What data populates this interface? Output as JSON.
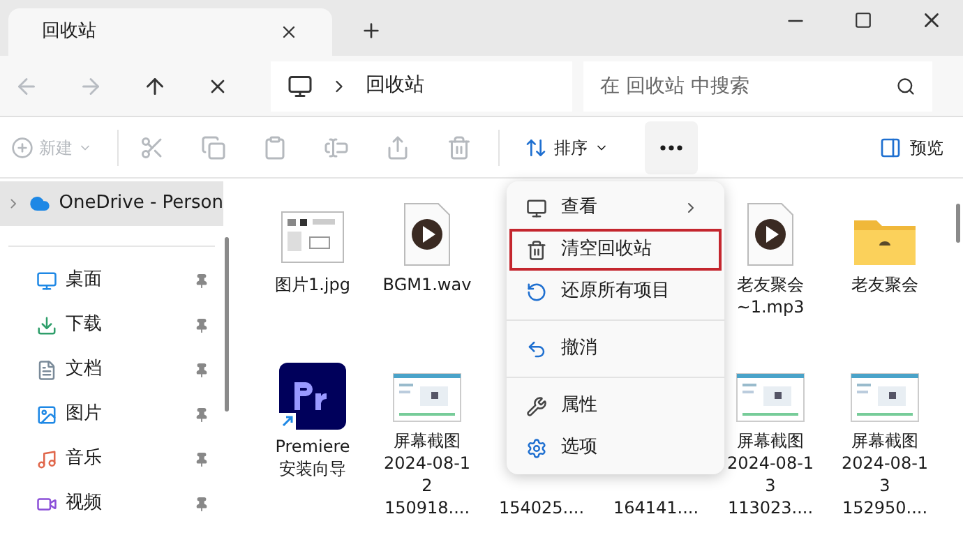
{
  "window": {
    "tab_title": "回收站"
  },
  "address": {
    "crumb": "回收站",
    "search_placeholder": "在 回收站 中搜索"
  },
  "toolbar": {
    "new": {
      "label": "新建",
      "disabled": true
    },
    "sort": {
      "label": "排序"
    },
    "preview": {
      "label": "预览"
    }
  },
  "sidebar": {
    "onedrive": {
      "label": "OneDrive - Person",
      "expanded": false
    },
    "items": [
      {
        "label": "桌面",
        "kind": "desktop",
        "pinned": true
      },
      {
        "label": "下载",
        "kind": "download",
        "pinned": true
      },
      {
        "label": "文档",
        "kind": "document",
        "pinned": true
      },
      {
        "label": "图片",
        "kind": "pictures",
        "pinned": true
      },
      {
        "label": "音乐",
        "kind": "music",
        "pinned": true
      },
      {
        "label": "视频",
        "kind": "video",
        "pinned": true
      }
    ]
  },
  "files": [
    {
      "kind": "image",
      "lines": [
        "图片1.jpg"
      ]
    },
    {
      "kind": "audio",
      "lines": [
        "BGM1.wav"
      ]
    },
    {
      "kind": "covered"
    },
    {
      "kind": "covered"
    },
    {
      "kind": "audio",
      "lines": [
        "老友聚会",
        "~1.mp3"
      ]
    },
    {
      "kind": "folder",
      "lines": [
        "老友聚会"
      ]
    },
    {
      "kind": "app",
      "lines": [
        "Premiere",
        "安装向导"
      ]
    },
    {
      "kind": "screenshot",
      "lines": [
        "屏幕截图",
        "2024-08-1",
        "2",
        "150918...."
      ]
    },
    {
      "kind": "covered",
      "lines": [
        "154025...."
      ]
    },
    {
      "kind": "covered",
      "lines": [
        "164141...."
      ]
    },
    {
      "kind": "screenshot",
      "lines": [
        "屏幕截图",
        "2024-08-1",
        "3",
        "113023...."
      ]
    },
    {
      "kind": "screenshot",
      "lines": [
        "屏幕截图",
        "2024-08-1",
        "3",
        "152950...."
      ]
    }
  ],
  "menu": [
    {
      "label": "查看",
      "kind": "view",
      "submenu": true,
      "highlighted": false,
      "separator_before": false
    },
    {
      "label": "清空回收站",
      "kind": "empty",
      "submenu": false,
      "highlighted": true,
      "separator_before": false
    },
    {
      "label": "还原所有项目",
      "kind": "restore",
      "submenu": false,
      "highlighted": false,
      "separator_before": false
    },
    {
      "label": "撤消",
      "kind": "undo",
      "submenu": false,
      "highlighted": false,
      "separator_before": true
    },
    {
      "label": "属性",
      "kind": "properties",
      "submenu": false,
      "highlighted": false,
      "separator_before": true
    },
    {
      "label": "选项",
      "kind": "options",
      "submenu": false,
      "highlighted": false,
      "separator_before": false
    }
  ]
}
